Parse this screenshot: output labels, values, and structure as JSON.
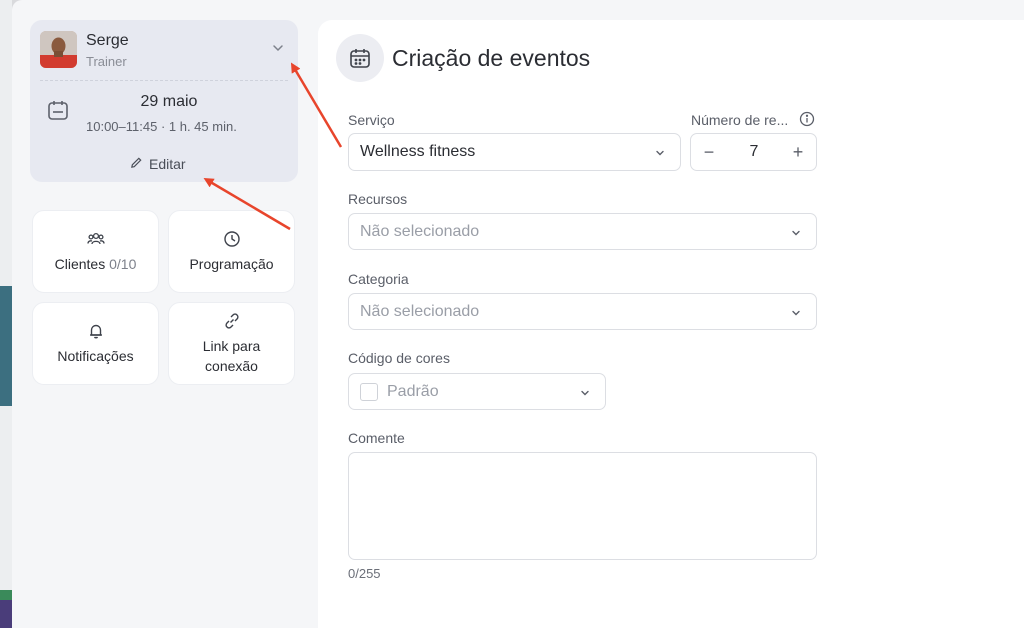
{
  "trainer": {
    "name": "Serge",
    "role": "Trainer"
  },
  "event": {
    "date": "29 maio",
    "time": "10:00–11:45 · 1 h. 45 min.",
    "edit_label": "Editar"
  },
  "tiles": [
    {
      "label": "Clientes",
      "count": "0/10",
      "icon": "users-icon"
    },
    {
      "label": "Programação",
      "icon": "clock-icon"
    },
    {
      "label": "Notificações",
      "icon": "bell-icon"
    },
    {
      "label_line1": "Link para",
      "label_line2": "conexão",
      "icon": "link-icon"
    }
  ],
  "form": {
    "title": "Criação de eventos",
    "service": {
      "label": "Serviço",
      "value": "Wellness fitness"
    },
    "reps": {
      "label": "Número de re...",
      "value": "7"
    },
    "resources": {
      "label": "Recursos",
      "placeholder": "Não selecionado"
    },
    "category": {
      "label": "Categoria",
      "placeholder": "Não selecionado"
    },
    "color": {
      "label": "Código de cores",
      "value": "Padrão"
    },
    "comment": {
      "label": "Comente",
      "counter": "0/255"
    }
  },
  "colors": {
    "annotation_arrow": "#e8452c"
  }
}
